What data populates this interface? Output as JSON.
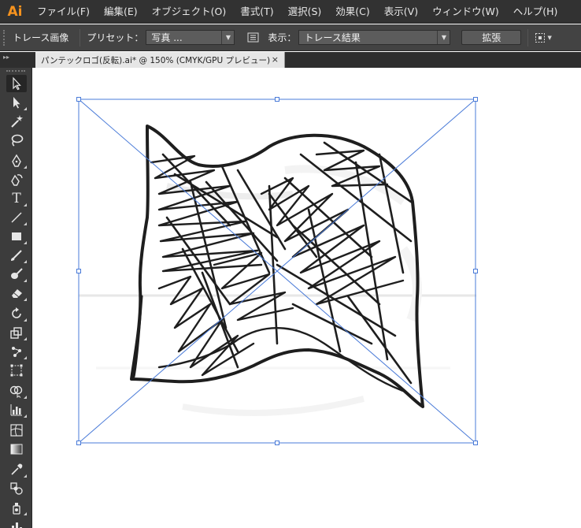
{
  "app": {
    "logo": "Ai"
  },
  "menu": [
    "ファイル(F)",
    "編集(E)",
    "オブジェクト(O)",
    "書式(T)",
    "選択(S)",
    "効果(C)",
    "表示(V)",
    "ウィンドウ(W)",
    "ヘルプ(H)"
  ],
  "controlbar": {
    "panel_title": "トレース画像",
    "preset_label": "プリセット：",
    "preset_value": "写真 ...",
    "view_label": "表示：",
    "view_value": "トレース結果",
    "expand_button": "拡張"
  },
  "document": {
    "tab_title": "パンテックロゴ(反転).ai* @ 150% (CMYK/GPU プレビュー)",
    "close_glyph": "×"
  },
  "tools": [
    "selection-tool",
    "direct-selection-tool",
    "magic-wand-tool",
    "lasso-tool",
    "pen-tool",
    "curvature-tool",
    "type-tool",
    "line-segment-tool",
    "rectangle-tool",
    "paintbrush-tool",
    "blob-brush-tool",
    "eraser-tool",
    "rotate-tool",
    "scale-tool",
    "puppet-warp-tool",
    "free-transform-tool",
    "shape-builder-tool",
    "graph-tool",
    "mesh-tool",
    "gradient-tool",
    "eyedropper-tool",
    "blend-tool",
    "symbol-sprayer-tool",
    "column-graph-tool"
  ],
  "tool_labels": {
    "type": "T"
  },
  "colors": {
    "menubar_bg": "#323232",
    "controlbar_bg": "#434343",
    "logo": "#f7931e",
    "selection_bbox": "#4a7bd8",
    "sketch_stroke": "#1e1e1e"
  }
}
